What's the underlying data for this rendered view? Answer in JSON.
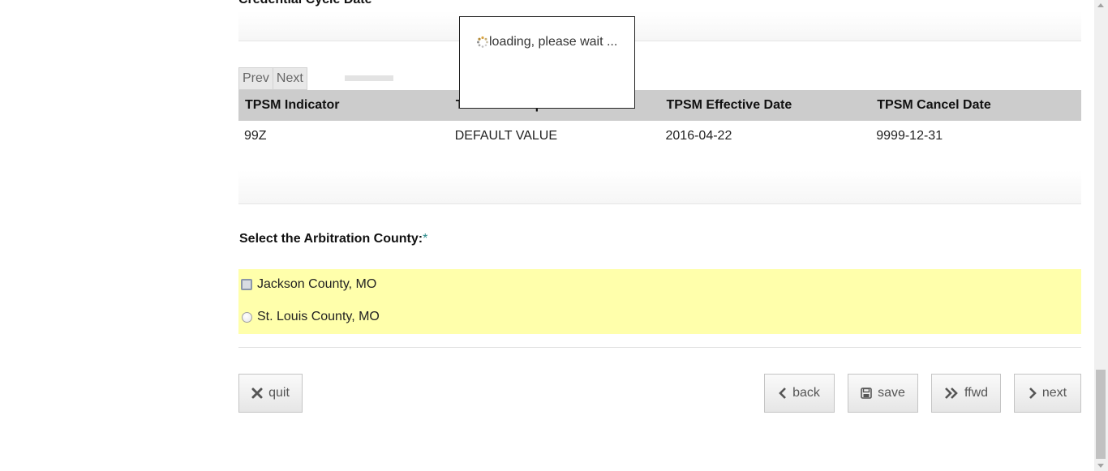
{
  "section": {
    "cut_header": "Credential Cycle Date"
  },
  "pager": {
    "prev_label": "Prev",
    "next_label": "Next"
  },
  "table": {
    "headers": [
      "TPSM Indicator",
      "TPSM Description",
      "TPSM Effective Date",
      "TPSM Cancel Date"
    ],
    "rows": [
      [
        "99Z",
        "DEFAULT VALUE",
        "2016-04-22",
        "9999-12-31"
      ]
    ]
  },
  "question": {
    "label": "Select the Arbitration County:",
    "required_mark": "*",
    "options": [
      {
        "label": "Jackson County, MO",
        "focused": true
      },
      {
        "label": "St. Louis County, MO",
        "focused": false
      }
    ]
  },
  "buttons": {
    "quit": "quit",
    "back": "back",
    "save": "save",
    "ffwd": "ffwd",
    "next": "next"
  },
  "loading": {
    "message": "loading, please wait ..."
  },
  "colors": {
    "options_highlight": "#ffffab",
    "header_bg": "#cccccc",
    "required": "#2a8a8a"
  }
}
